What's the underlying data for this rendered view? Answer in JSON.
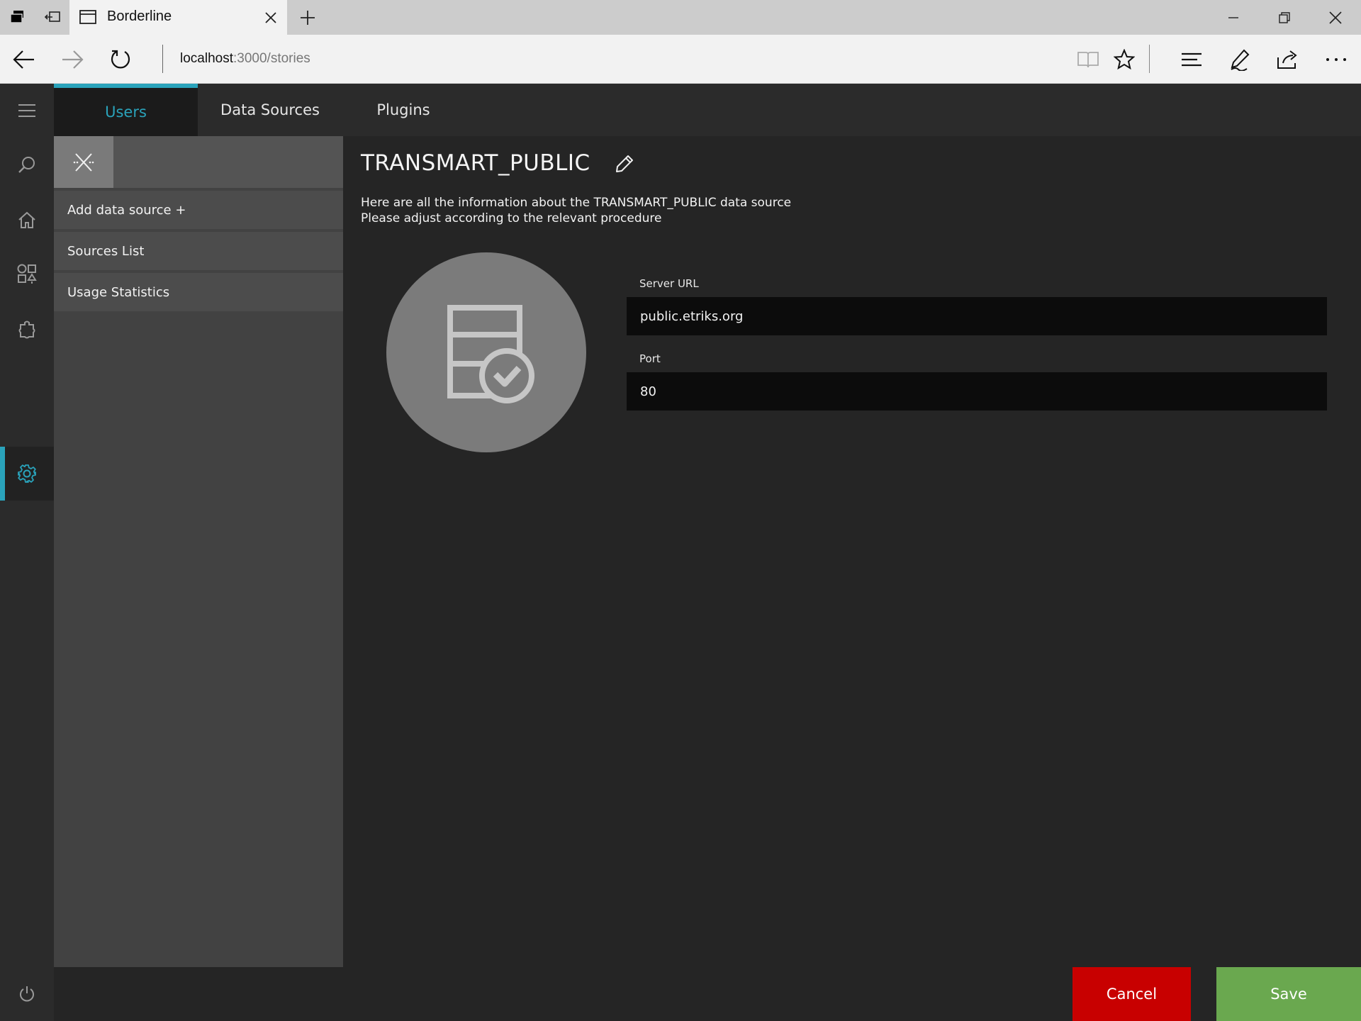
{
  "browser": {
    "tab_title": "Borderline",
    "url_host": "localhost",
    "url_rest": ":3000/stories",
    "icons": [
      "tab-actions-icon",
      "set-aside-tabs-icon",
      "page-icon",
      "close-icon",
      "plus-icon",
      "minimize-icon",
      "restore-icon",
      "close-window-icon",
      "back-icon",
      "forward-icon",
      "refresh-icon",
      "reading-view-icon",
      "favorite-star-icon",
      "hub-icon",
      "web-note-icon",
      "share-icon",
      "more-icon"
    ]
  },
  "app": {
    "accent_color": "#2aa3bb",
    "left_bar": {
      "icons": [
        "menu-icon",
        "search-icon",
        "home-icon",
        "workflows-icon",
        "plugins-icon",
        "settings-icon",
        "power-icon"
      ],
      "active": "settings-icon"
    },
    "top_nav": {
      "tabs": [
        {
          "label": "Users",
          "active": true
        },
        {
          "label": "Data Sources",
          "active": false
        },
        {
          "label": "Plugins",
          "active": false
        }
      ]
    },
    "side_panel": {
      "items": [
        {
          "label": "Add data source +"
        },
        {
          "label": "Sources List"
        },
        {
          "label": "Usage Statistics"
        }
      ]
    },
    "main": {
      "title": "TRANSMART_PUBLIC",
      "description_line1": "Here are all the information about the TRANSMART_PUBLIC data source",
      "description_line2": "Please adjust according to the relevant procedure",
      "avatar_icon": "database-check-icon",
      "fields": [
        {
          "label": "Server URL",
          "value": "public.etriks.org"
        },
        {
          "label": "Port",
          "value": "80"
        }
      ]
    },
    "footer": {
      "cancel_label": "Cancel",
      "save_label": "Save",
      "cancel_color": "#c80000",
      "save_color": "#6aa84f"
    }
  }
}
